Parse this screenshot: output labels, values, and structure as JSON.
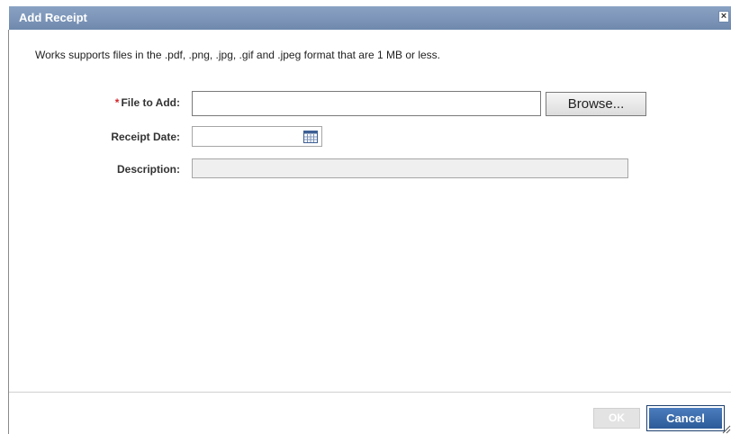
{
  "dialog": {
    "title": "Add Receipt",
    "close_symbol": "×",
    "intro": "Works supports files in the .pdf, .png, .jpg, .gif and .jpeg format that are 1 MB or less."
  },
  "form": {
    "file": {
      "required_marker": "*",
      "label": "File to Add:",
      "value": "",
      "browse_label": "Browse..."
    },
    "receipt_date": {
      "label": "Receipt Date:",
      "value": "",
      "icon": "calendar-icon"
    },
    "description": {
      "label": "Description:",
      "value": ""
    }
  },
  "footer": {
    "ok_label": "OK",
    "cancel_label": "Cancel"
  },
  "colors": {
    "titlebar": "#7a93b8",
    "required": "#d4262a",
    "cancel_button": "#3a6aa8"
  }
}
